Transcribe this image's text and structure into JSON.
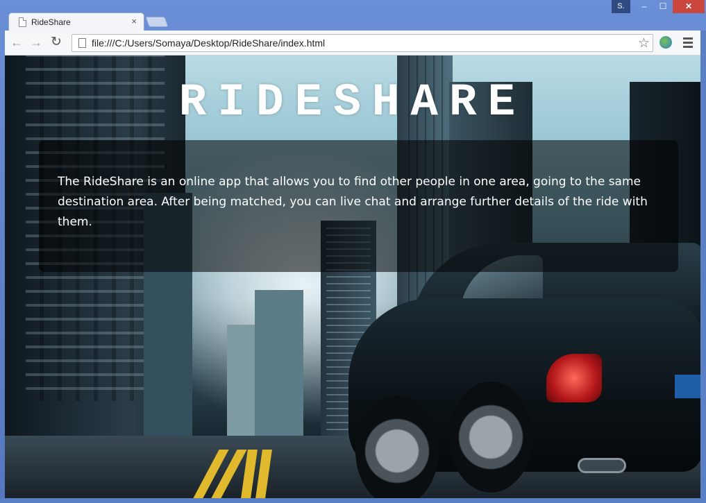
{
  "browser": {
    "tab_title": "RideShare",
    "tab_close": "×",
    "user_badge": "S.",
    "url": "file:///C:/Users/Somaya/Desktop/RideShare/index.html",
    "window_min": "–",
    "window_max": "☐",
    "window_close": "✕",
    "back_glyph": "←",
    "forward_glyph": "→",
    "reload_glyph": "↻",
    "star_glyph": "☆",
    "icons": [
      "page-icon",
      "back-arrow-icon",
      "forward-arrow-icon",
      "reload-icon",
      "star-icon",
      "extension-globe-icon",
      "menu-icon"
    ]
  },
  "page": {
    "title": "RIDESHARE",
    "description": "The RideShare is an online app that allows you to find other people in one area, going to the same destination area. After being matched, you can live chat and arrange further details of the ride with them."
  },
  "colors": {
    "window_frame": "#5b7fc4",
    "close_button": "#c9463d",
    "panel_overlay": "rgba(0,0,0,0.55)",
    "title_text": "#ffffff"
  }
}
